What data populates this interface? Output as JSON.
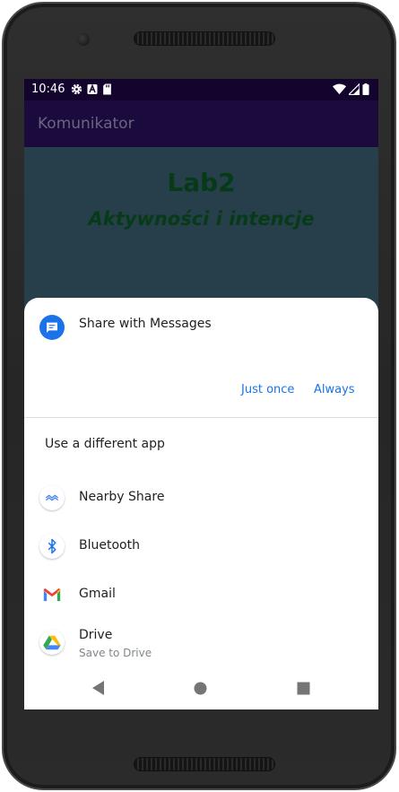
{
  "status_bar": {
    "time": "10:46",
    "left_icons": [
      "gear-icon",
      "font-a-icon",
      "sd-card-icon"
    ],
    "right_icons": [
      "wifi-icon",
      "signal-icon",
      "battery-icon"
    ]
  },
  "app_bar": {
    "title": "Komunikator"
  },
  "content": {
    "title": "Lab2",
    "subtitle": "Aktywności i intencje"
  },
  "share_sheet": {
    "default_app": {
      "label": "Share with Messages",
      "icon": "messages-icon",
      "icon_color": "#1a73e8"
    },
    "buttons": {
      "just_once": "Just once",
      "always": "Always"
    },
    "different_app_label": "Use a different app",
    "apps": [
      {
        "name": "Nearby Share",
        "subtitle": "",
        "icon": "nearby-share-icon"
      },
      {
        "name": "Bluetooth",
        "subtitle": "",
        "icon": "bluetooth-icon"
      },
      {
        "name": "Gmail",
        "subtitle": "",
        "icon": "gmail-icon"
      },
      {
        "name": "Drive",
        "subtitle": "Save to Drive",
        "icon": "drive-icon"
      }
    ]
  },
  "nav_bar": {
    "buttons": [
      "back-icon",
      "home-icon",
      "recents-icon"
    ]
  },
  "colors": {
    "status_bar": "#13042e",
    "app_bar": "#1b0a3c",
    "content_background": "#263f4a",
    "title_text": "#073a17",
    "accent": "#1a73e8"
  }
}
